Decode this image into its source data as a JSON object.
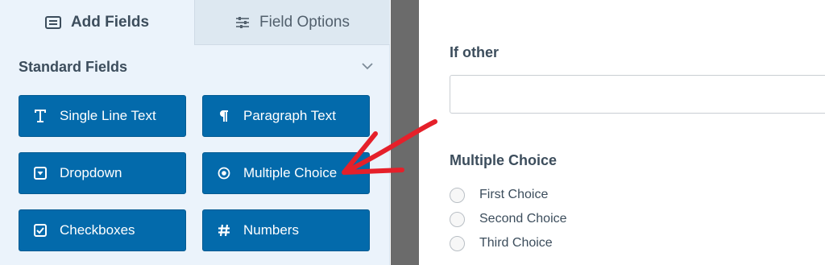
{
  "tabs": {
    "add_fields": "Add Fields",
    "field_options": "Field Options"
  },
  "section": {
    "title": "Standard Fields"
  },
  "fields": [
    {
      "label": "Single Line Text",
      "icon": "text-cursor-icon"
    },
    {
      "label": "Paragraph Text",
      "icon": "paragraph-icon"
    },
    {
      "label": "Dropdown",
      "icon": "dropdown-icon"
    },
    {
      "label": "Multiple Choice",
      "icon": "radio-icon"
    },
    {
      "label": "Checkboxes",
      "icon": "checkbox-icon"
    },
    {
      "label": "Numbers",
      "icon": "hash-icon"
    }
  ],
  "preview": {
    "if_other_label": "If other",
    "multiple_choice_label": "Multiple Choice",
    "choices": [
      "First Choice",
      "Second Choice",
      "Third Choice"
    ]
  },
  "colors": {
    "button_blue": "#036aab",
    "panel_bg": "#ebf3fb",
    "arrow_red": "#e5202a"
  }
}
